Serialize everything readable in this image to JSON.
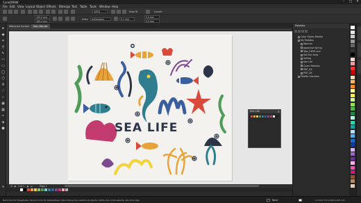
{
  "app": {
    "title": "CorelDRAW",
    "window_controls": [
      "–",
      "□",
      "✕"
    ]
  },
  "menu": [
    "File",
    "Edit",
    "View",
    "Layout",
    "Object",
    "Effects",
    "Bitmaps",
    "Text",
    "Table",
    "Tools",
    "Window",
    "Help"
  ],
  "toolbar": {
    "zoom": "100%",
    "snap_to": "Snap To",
    "launch": "Launch",
    "x_field": "103.2 mm",
    "y_field": "185.4 mm",
    "units_label": "Units:",
    "units_value": "millimeters",
    "nudge_value": "0.1 mm",
    "duplicate_h": "5.0 mm",
    "duplicate_v": "5.0 mm"
  },
  "doc_tabs": [
    {
      "label": "Welcome Screen",
      "active": false
    },
    {
      "label": "Sea Life.cdr",
      "active": true
    }
  ],
  "artwork": {
    "title_text": "SEA LIFE"
  },
  "palette_docker": {
    "title": "Sea Life",
    "swatch_colors": [
      "#d94a3a",
      "#e8a33a",
      "#f3d23a",
      "#4f9b5a",
      "#2f7d8f",
      "#3b5f9e",
      "#7a4b8f",
      "#c23b6f",
      "#f0f0f0",
      "#1a1a1a"
    ]
  },
  "page_nav": {
    "page_count": "1 of 1",
    "page_label": "Page 1"
  },
  "right_panel": {
    "title": "Palettes",
    "items": [
      {
        "label": "Color Styles Palette",
        "indent": 1
      },
      {
        "label": "My Palettes",
        "indent": 1
      },
      {
        "label": "Warmer",
        "indent": 2
      },
      {
        "label": "Japanese Spring",
        "indent": 2
      },
      {
        "label": "Test_CMYK.xml",
        "indent": 2
      },
      {
        "label": "Sail the Seas",
        "indent": 2
      },
      {
        "label": "Sailing",
        "indent": 2
      },
      {
        "label": "Sea Life",
        "indent": 2
      },
      {
        "label": "Cozer Palettes",
        "indent": 2
      },
      {
        "label": "PDF_XX",
        "indent": 2
      },
      {
        "label": "PDF_XX",
        "indent": 2
      },
      {
        "label": "Palette Libraries",
        "indent": 1
      }
    ]
  },
  "status": {
    "hint": "Next click for Drag/Scale; Second click for Rotate/Skew; Dbl-clicking tool selects all objects; Shift+click multi-selects; Alt+click digs",
    "fill": "None",
    "cmyk": "C:0 M:0 Y:0 K:100  0.200 mm"
  },
  "colors": {
    "app_bg": "#2b2b2b",
    "page_bg": "#f4f2ee",
    "title_text": "#2c3448"
  },
  "doc_palette_colors": [
    "#ffffff",
    "#000000",
    "#d94a3a",
    "#e8a33a",
    "#f3d23a",
    "#8fc16a",
    "#4f9b5a",
    "#7fc6d0",
    "#2f7d8f",
    "#3b5f9e",
    "#7a4b8f",
    "#c23b6f",
    "#f5a6b0",
    "#b0b0b0"
  ],
  "color_strip_colors": [
    "#ffffff",
    "#e6e6e6",
    "#cccccc",
    "#999999",
    "#666666",
    "#333333",
    "#000000",
    "#ffd5d5",
    "#ff9999",
    "#ff3333",
    "#cc0000",
    "#ffe0b3",
    "#ffb84d",
    "#ff8c1a",
    "#ffff99",
    "#ffee33",
    "#ccff99",
    "#99e04d",
    "#4db84d",
    "#1a8c3d",
    "#b3ffe6",
    "#33d6b0",
    "#1aa3a3",
    "#b3e0ff",
    "#4db0ff",
    "#1a6bcc",
    "#0d3d99",
    "#d9b3ff",
    "#9966cc",
    "#66338c",
    "#ffb3e6",
    "#ff4db8",
    "#cc1a80",
    "#8c5a33",
    "#b38c66",
    "#e6ccb3"
  ]
}
